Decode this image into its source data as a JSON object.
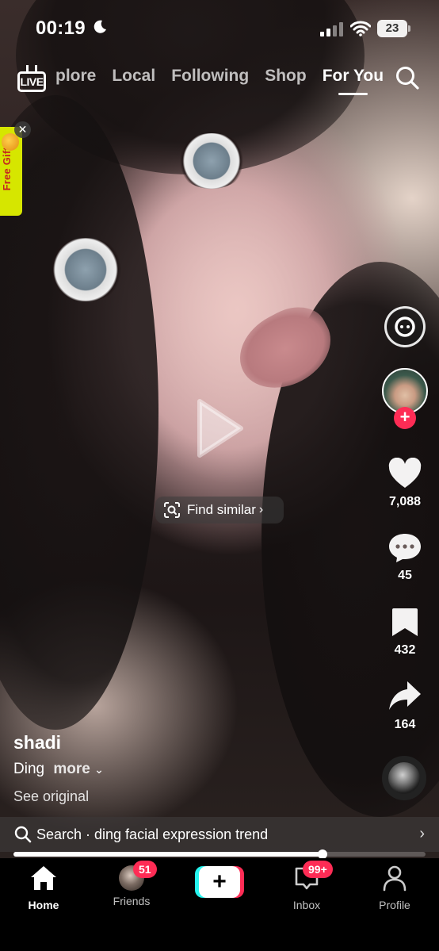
{
  "status_bar": {
    "time": "00:19",
    "battery": "23"
  },
  "top_nav": {
    "live_label": "LIVE",
    "tabs": [
      {
        "label": "plore"
      },
      {
        "label": "Local"
      },
      {
        "label": "Following"
      },
      {
        "label": "Shop"
      },
      {
        "label": "For You"
      }
    ],
    "active_tab": "For You"
  },
  "promo": {
    "free_gifts_label": "Free Gifts"
  },
  "find_similar": {
    "label": "Find similar"
  },
  "right_rail": {
    "likes": "7,088",
    "comments": "45",
    "saves": "432",
    "shares": "164"
  },
  "caption": {
    "author": "shadi",
    "description": "Ding",
    "more_label": "more",
    "see_original": "See original"
  },
  "search_bar": {
    "text": "Search · ding facial expression trend"
  },
  "progress": {
    "fraction": 0.75
  },
  "bottom_nav": {
    "items": [
      {
        "label": "Home"
      },
      {
        "label": "Friends",
        "badge": "51"
      },
      {
        "label": "Inbox",
        "badge": "99+"
      },
      {
        "label": "Profile"
      }
    ]
  },
  "colors": {
    "accent_red": "#fe2c55",
    "accent_cyan": "#25f4ee",
    "promo_yellow": "#d6e600"
  },
  "icons": [
    "moon-icon",
    "signal-icon",
    "wifi-icon",
    "battery-icon",
    "live-tv-icon",
    "search-icon",
    "close-icon",
    "play-icon",
    "scan-icon",
    "chevron-right-icon",
    "reveal-icon",
    "heart-icon",
    "comment-icon",
    "bookmark-icon",
    "share-icon",
    "home-icon",
    "plus-icon",
    "inbox-icon",
    "profile-icon"
  ]
}
